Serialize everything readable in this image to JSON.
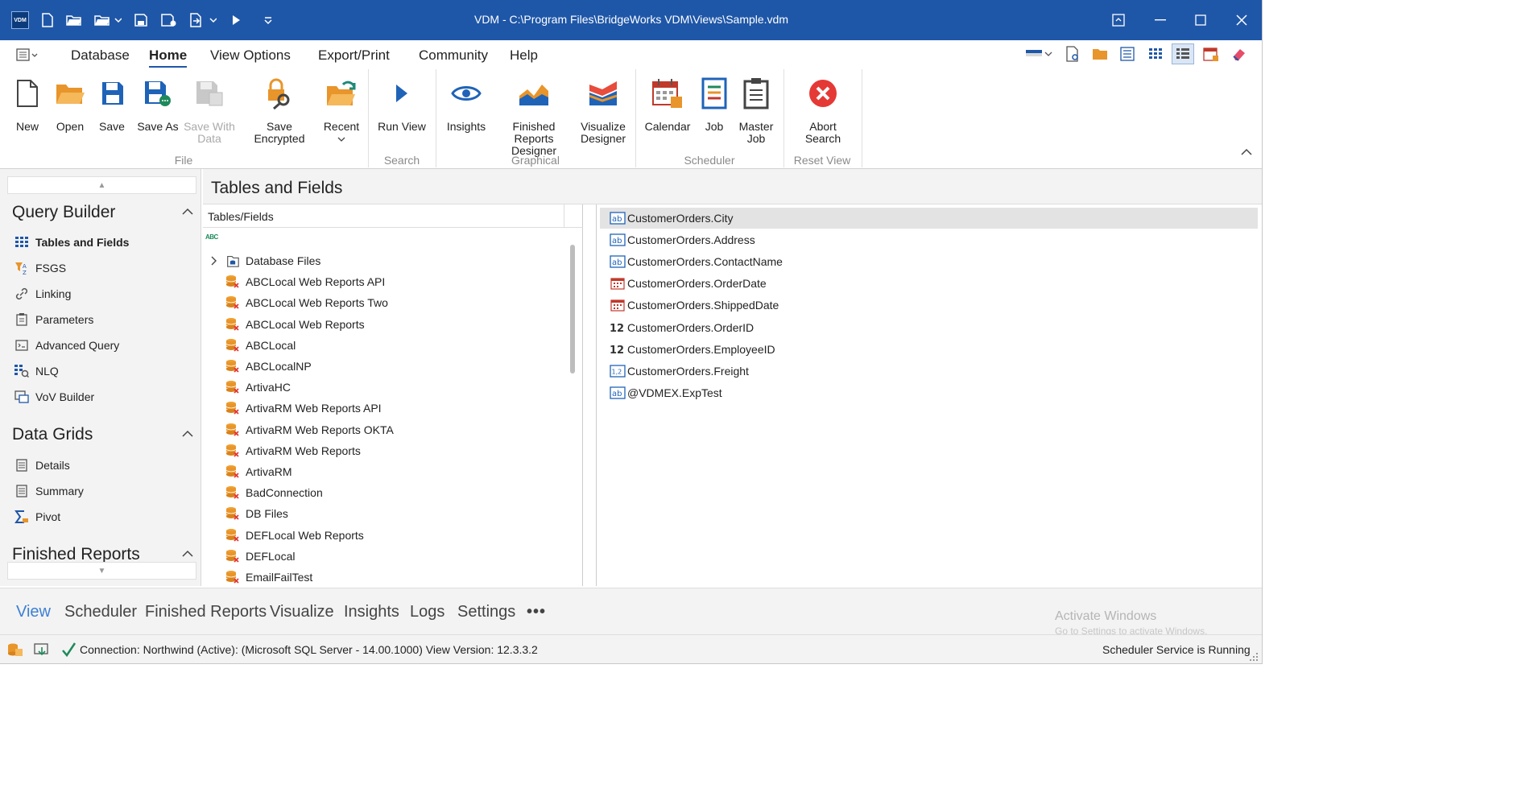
{
  "window": {
    "title": "VDM - C:\\Program Files\\BridgeWorks VDM\\Views\\Sample.vdm",
    "logo_text": "VDM"
  },
  "menu": {
    "items": [
      "Database",
      "Home",
      "View Options",
      "Export/Print",
      "Community",
      "Help"
    ],
    "active": "Home"
  },
  "ribbon": {
    "file": {
      "label": "File",
      "buttons": [
        {
          "label": "New",
          "icon": "new-doc-icon"
        },
        {
          "label": "Open",
          "icon": "folder-open-icon"
        },
        {
          "label": "Save",
          "icon": "save-icon"
        },
        {
          "label": "Save As",
          "icon": "save-as-icon"
        },
        {
          "label": "Save With",
          "label2": "Data",
          "icon": "save-with-data-icon",
          "disabled": true
        },
        {
          "label": "Save Encrypted",
          "icon": "lock-key-icon"
        },
        {
          "label": "Recent",
          "icon": "folder-recent-icon"
        }
      ]
    },
    "search": {
      "label": "Search",
      "buttons": [
        {
          "label": "Run View",
          "icon": "play-icon"
        }
      ]
    },
    "graphical": {
      "label": "Graphical",
      "buttons": [
        {
          "label": "Insights",
          "icon": "eye-icon"
        },
        {
          "label": "Finished Reports",
          "label2": "Designer",
          "icon": "area-chart-icon"
        },
        {
          "label": "Visualize",
          "label2": "Designer",
          "icon": "visualize-icon"
        }
      ]
    },
    "scheduler": {
      "label": "Scheduler",
      "buttons": [
        {
          "label": "Calendar",
          "icon": "calendar-icon"
        },
        {
          "label": "Job",
          "icon": "job-icon"
        },
        {
          "label": "Master",
          "label2": "Job",
          "icon": "clipboard-icon"
        }
      ]
    },
    "reset": {
      "label": "Reset View",
      "buttons": [
        {
          "label": "Abort",
          "label2": "Search",
          "icon": "abort-icon"
        }
      ]
    }
  },
  "leftnav": {
    "sections": [
      {
        "title": "Query Builder",
        "items": [
          "Tables and Fields",
          "FSGS",
          "Linking",
          "Parameters",
          "Advanced Query",
          "NLQ",
          "VoV Builder"
        ]
      },
      {
        "title": "Data Grids",
        "items": [
          "Details",
          "Summary",
          "Pivot"
        ]
      },
      {
        "title": "Finished Reports",
        "items": []
      }
    ],
    "active_item": "Tables and Fields"
  },
  "main": {
    "title": "Tables and Fields",
    "tree_header": "Tables/Fields",
    "abc_icon": "ABC",
    "tree_items": [
      "Database Files",
      "ABCLocal Web Reports API",
      "ABCLocal Web Reports Two",
      "ABCLocal Web Reports",
      "ABCLocal",
      "ABCLocalNP",
      "ArtivaHC",
      "ArtivaRM Web Reports API",
      "ArtivaRM Web Reports OKTA",
      "ArtivaRM Web Reports",
      "ArtivaRM",
      "BadConnection",
      "DB Files",
      "DEFLocal Web Reports",
      "DEFLocal",
      "EmailFailTest"
    ],
    "fields": [
      {
        "label": "CustomerOrders.City",
        "type": "text"
      },
      {
        "label": "CustomerOrders.Address",
        "type": "text"
      },
      {
        "label": "CustomerOrders.ContactName",
        "type": "text"
      },
      {
        "label": "CustomerOrders.OrderDate",
        "type": "date"
      },
      {
        "label": "CustomerOrders.ShippedDate",
        "type": "date"
      },
      {
        "label": "CustomerOrders.OrderID",
        "type": "int"
      },
      {
        "label": "CustomerOrders.EmployeeID",
        "type": "int"
      },
      {
        "label": "CustomerOrders.Freight",
        "type": "decimal"
      },
      {
        "label": "@VDMEX.ExpTest",
        "type": "text"
      }
    ],
    "selected_field": "CustomerOrders.City"
  },
  "bottom_tabs": {
    "items": [
      "View",
      "Scheduler",
      "Finished Reports",
      "Visualize",
      "Insights",
      "Logs",
      "Settings"
    ],
    "more": "•••",
    "active": "View"
  },
  "watermark": {
    "line1": "Activate Windows",
    "line2": "Go to Settings to activate Windows."
  },
  "status": {
    "connection": "Connection: Northwind (Active): (Microsoft SQL Server - 14.00.1000) View Version: 12.3.3.2",
    "scheduler": "Scheduler Service is Running"
  }
}
